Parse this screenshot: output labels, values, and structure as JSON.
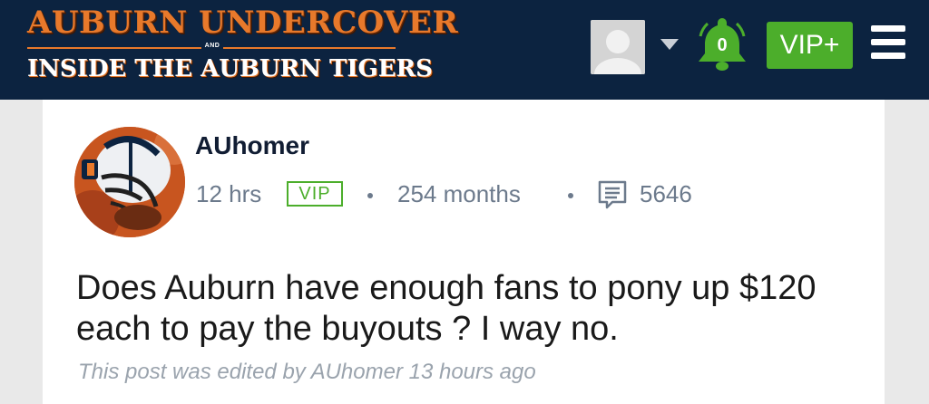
{
  "header": {
    "logo_line1": "AUBURN UNDERCOVER",
    "logo_and": "AND",
    "logo_line2": "INSIDE THE AUBURN TIGERS",
    "notification_count": "0",
    "vip_button_label": "VIP+",
    "icons": [
      "user-avatar",
      "chevron-down-icon",
      "bell-icon",
      "menu-icon"
    ]
  },
  "post": {
    "username": "AUhomer",
    "time_ago": "12 hrs",
    "badge": "VIP",
    "membership": "254 months",
    "post_count": "5646",
    "body": "Does Auburn have enough fans to pony up $120 each to pay the buyouts ? I way no.",
    "edited_note": "This post was edited by AUhomer 13 hours ago"
  },
  "colors": {
    "navbar": "#0c2340",
    "auburn_orange": "#e8792b",
    "accent_green": "#4cae2b",
    "meta_text": "#6c7a8c",
    "page_bg": "#e9e9e9"
  }
}
